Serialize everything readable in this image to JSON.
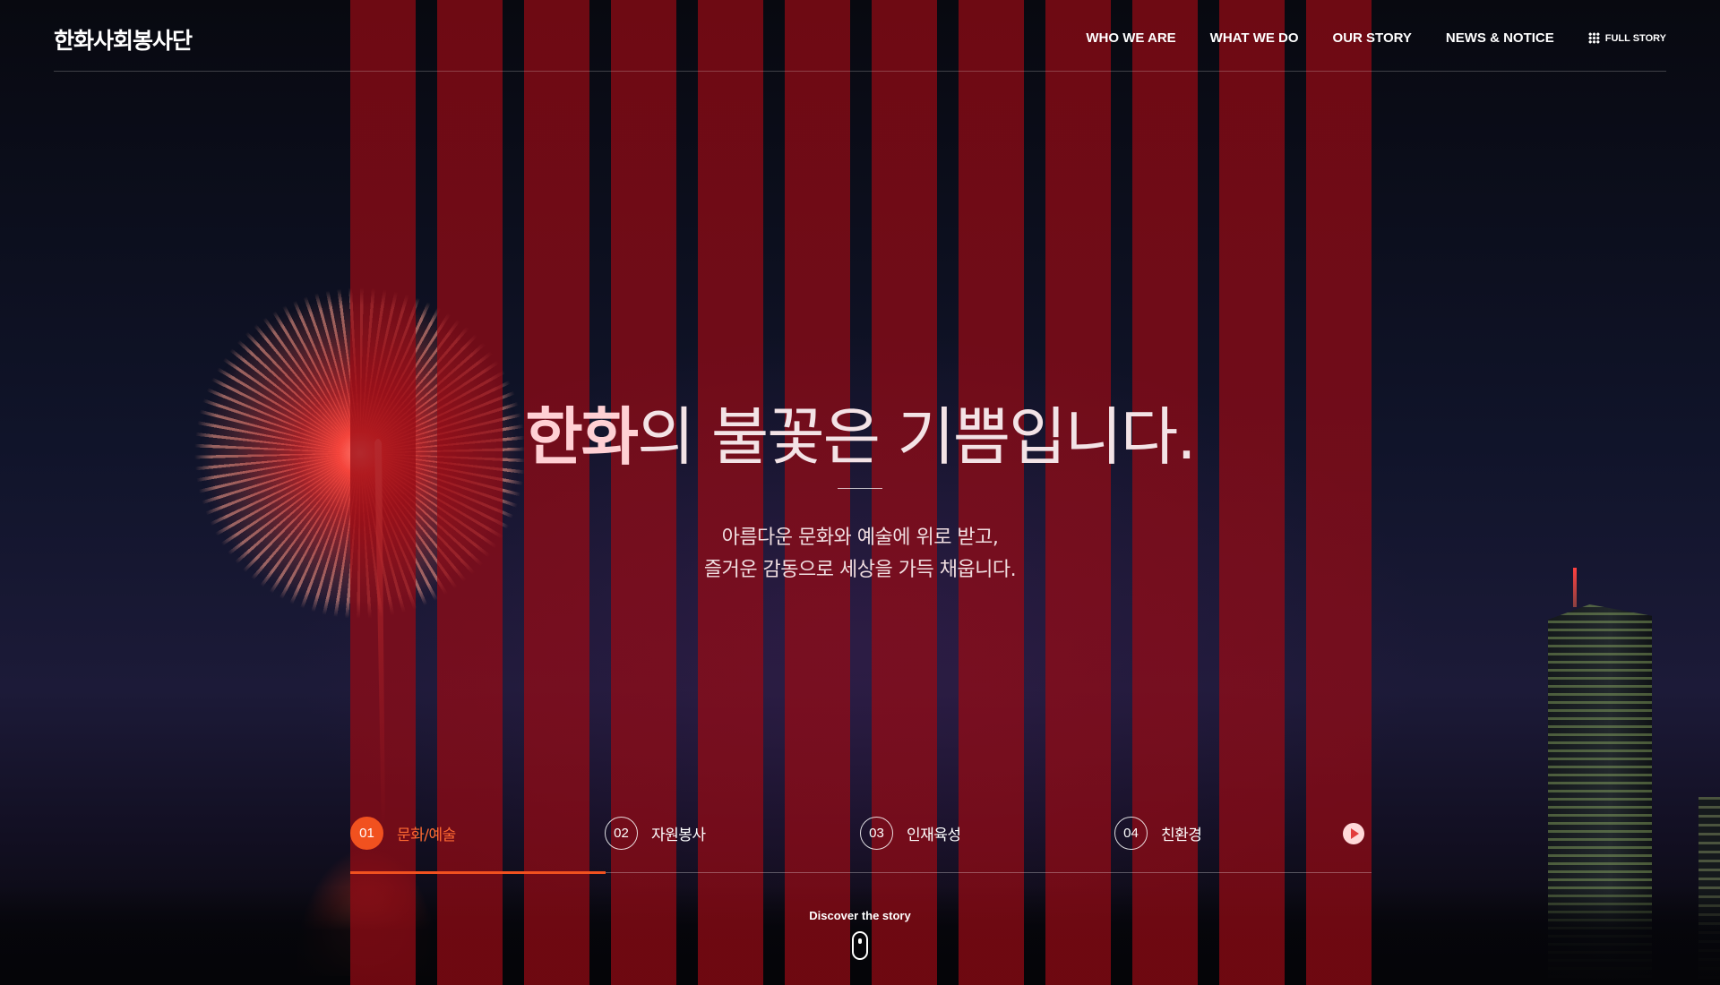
{
  "header": {
    "logo": "한화사회봉사단",
    "nav": [
      {
        "label": "WHO WE ARE"
      },
      {
        "label": "WHAT WE DO"
      },
      {
        "label": "OUR STORY"
      },
      {
        "label": "NEWS & NOTICE"
      }
    ],
    "full_story": {
      "label": "FULL STORY",
      "icon": "grid-icon"
    }
  },
  "hero": {
    "title_accent": "한화",
    "title_rest": "의 불꽃은 기쁨입니다.",
    "subtitle_line1": "아름다운 문화와 예술에 위로 받고,",
    "subtitle_line2": "즐거운 감동으로 세상을 가득 채웁니다."
  },
  "tabs": {
    "items": [
      {
        "num": "01",
        "label": "문화/예술",
        "active": true
      },
      {
        "num": "02",
        "label": "자원봉사",
        "active": false
      },
      {
        "num": "03",
        "label": "인재육성",
        "active": false
      },
      {
        "num": "04",
        "label": "친환경",
        "active": false
      }
    ],
    "play_icon": "play-icon",
    "progress_fraction": 0.25
  },
  "discover": {
    "label": "Discover the story",
    "icon": "mouse-scroll-icon"
  },
  "colors": {
    "accent": "#f1511f",
    "stripe": "#960a14",
    "play_button": "#ffd9d9"
  }
}
